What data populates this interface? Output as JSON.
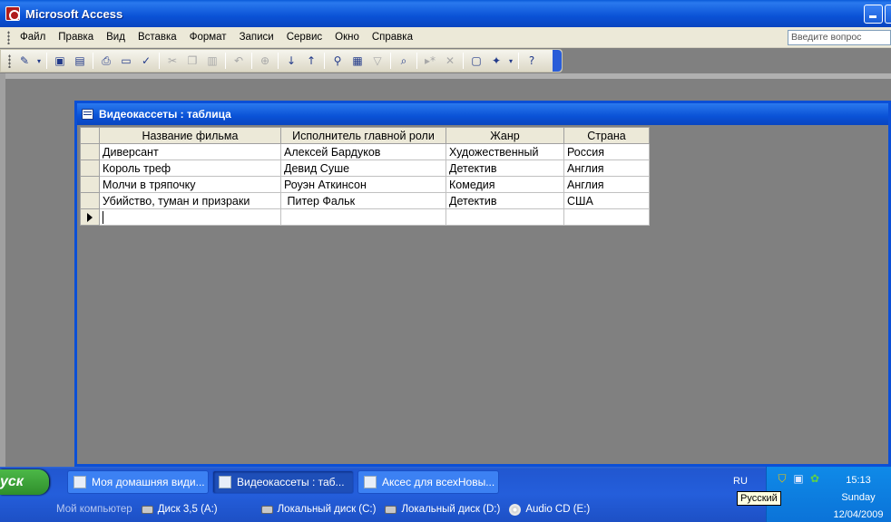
{
  "app": {
    "title": "Microsoft Access"
  },
  "menu": {
    "items": [
      "Файл",
      "Правка",
      "Вид",
      "Вставка",
      "Формат",
      "Записи",
      "Сервис",
      "Окно",
      "Справка"
    ],
    "help_placeholder": "Введите вопрос"
  },
  "toolbar": {
    "icons": [
      "design-view-icon",
      "save-icon",
      "save-as-icon",
      "print-icon",
      "print-preview-icon",
      "spelling-icon",
      "cut-icon",
      "copy-icon",
      "paste-icon",
      "undo-icon",
      "hyperlink-icon",
      "sort-ascending-icon",
      "sort-descending-icon",
      "filter-by-selection-icon",
      "filter-by-form-icon",
      "apply-filter-icon",
      "find-icon",
      "new-record-icon",
      "delete-record-icon",
      "database-window-icon",
      "new-object-icon",
      "help-icon"
    ]
  },
  "table_window": {
    "title": "Видеокассеты : таблица",
    "columns": [
      "Название фильма",
      "Исполнитель главной роли",
      "Жанр",
      "Страна"
    ],
    "rows": [
      [
        "Диверсант",
        "Алексей Бардуков",
        "Художественный",
        "Россия"
      ],
      [
        "Король треф",
        "Девид Суше",
        "Детектив",
        "Англия"
      ],
      [
        "Молчи в тряпочку",
        "Роуэн Аткинсон",
        "Комедия",
        "Англия"
      ],
      [
        "Убийство, туман и призраки",
        " Питер Фальк",
        "Детектив",
        "США"
      ]
    ]
  },
  "taskbar": {
    "start_label": "уск",
    "tasks": [
      "Моя домашняя види...",
      "Видеокассеты : таб...",
      "Аксес для всехНовы..."
    ],
    "language": "RU",
    "tooltip": "Русский",
    "clock": {
      "time": "15:13",
      "day": "Sunday",
      "date": "12/04/2009"
    },
    "drives": [
      "Мой компьютер",
      "Диск 3,5 (A:)",
      "Локальный диск (C:)",
      "Локальный диск (D:)",
      "Audio CD (E:)"
    ]
  }
}
